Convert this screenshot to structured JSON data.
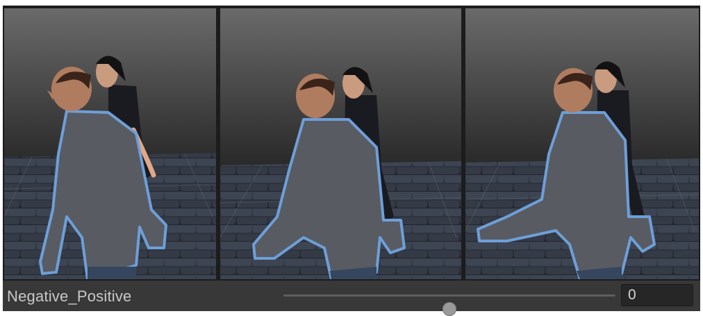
{
  "slider": {
    "label": "Negative_Positive",
    "value": "0",
    "min": -1,
    "max": 1,
    "fraction": 0.5
  },
  "panels": [
    {
      "pose": "arms-down"
    },
    {
      "pose": "arm-slightly-forward"
    },
    {
      "pose": "arm-raised-forward"
    }
  ],
  "colors": {
    "frame_bg": "#1c1c1c",
    "control_bg": "#383838",
    "outline_blue": "#6e9fd8",
    "label_text": "#c8c8c8"
  }
}
